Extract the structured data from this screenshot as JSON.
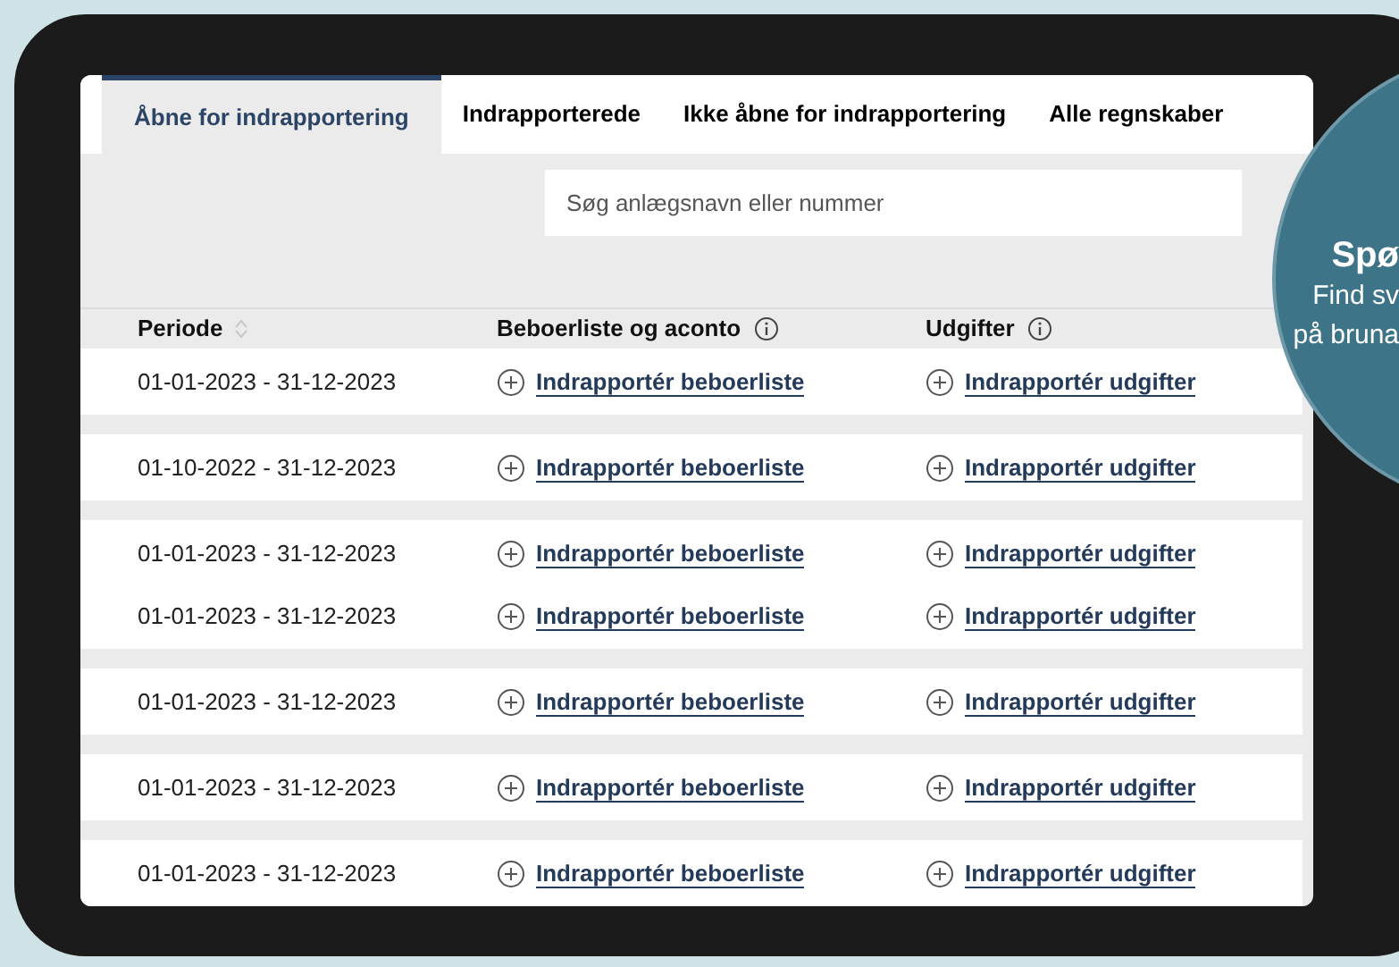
{
  "tabs": [
    {
      "label": "Åbne for indrapportering",
      "selected": true
    },
    {
      "label": "Indrapporterede",
      "selected": false
    },
    {
      "label": "Ikke åbne for indrapportering",
      "selected": false
    },
    {
      "label": "Alle regnskaber",
      "selected": false
    }
  ],
  "search": {
    "placeholder": "Søg anlægsnavn eller nummer"
  },
  "table": {
    "columns": [
      {
        "label": "Periode",
        "kind": "sortable"
      },
      {
        "label": "Beboerliste og aconto",
        "kind": "info"
      },
      {
        "label": "Udgifter",
        "kind": "info"
      }
    ],
    "groups": [
      {
        "rows": [
          {
            "period": "01-01-2023 - 31-12-2023",
            "beboerliste": "Indrapportér beboerliste",
            "udgifter": "Indrapportér udgifter"
          }
        ]
      },
      {
        "rows": [
          {
            "period": "01-10-2022 - 31-12-2023",
            "beboerliste": "Indrapportér beboerliste",
            "udgifter": "Indrapportér udgifter"
          }
        ]
      },
      {
        "rows": [
          {
            "period": "01-01-2023 - 31-12-2023",
            "beboerliste": "Indrapportér beboerliste",
            "udgifter": "Indrapportér udgifter"
          },
          {
            "period": "01-01-2023 - 31-12-2023",
            "beboerliste": "Indrapportér beboerliste",
            "udgifter": "Indrapportér udgifter"
          }
        ]
      },
      {
        "rows": [
          {
            "period": "01-01-2023 - 31-12-2023",
            "beboerliste": "Indrapportér beboerliste",
            "udgifter": "Indrapportér udgifter"
          }
        ]
      },
      {
        "rows": [
          {
            "period": "01-01-2023 - 31-12-2023",
            "beboerliste": "Indrapportér beboerliste",
            "udgifter": "Indrapportér udgifter"
          }
        ]
      },
      {
        "rows": [
          {
            "period": "01-01-2023 - 31-12-2023",
            "beboerliste": "Indrapportér beboerliste",
            "udgifter": "Indrapportér udgifter"
          }
        ]
      }
    ]
  },
  "promo": {
    "title": "Spø",
    "lines": [
      "Find sv",
      "på bruna"
    ]
  }
}
